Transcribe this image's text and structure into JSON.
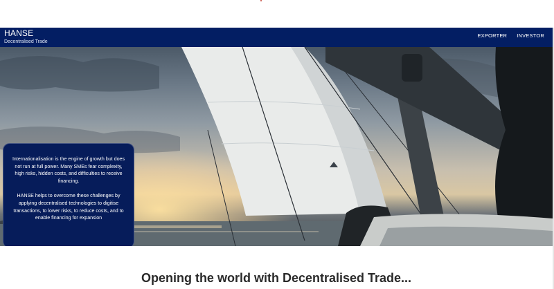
{
  "navbar": {
    "brand_title": "HANSE",
    "brand_subtitle": "Decentralised Trade",
    "links": [
      "EXPORTER",
      "INVESTOR"
    ],
    "background": "#031e63"
  },
  "hero": {
    "image": "sailboat-at-sunset",
    "card": {
      "paragraph1": "Internationalisation is the engine of growth but does not run at full power. Many SMEs fear complexity, high risks, hidden costs, and difficulties to receive financing.",
      "paragraph2": "HANSE helps to overcome these challenges by applying decentralised technologies to digitise transactions, to lower risks, to reduce costs, and to enable financing for expansion",
      "background": "#061c5a"
    }
  },
  "main": {
    "tagline": "Opening the world with Decentralised Trade..."
  }
}
